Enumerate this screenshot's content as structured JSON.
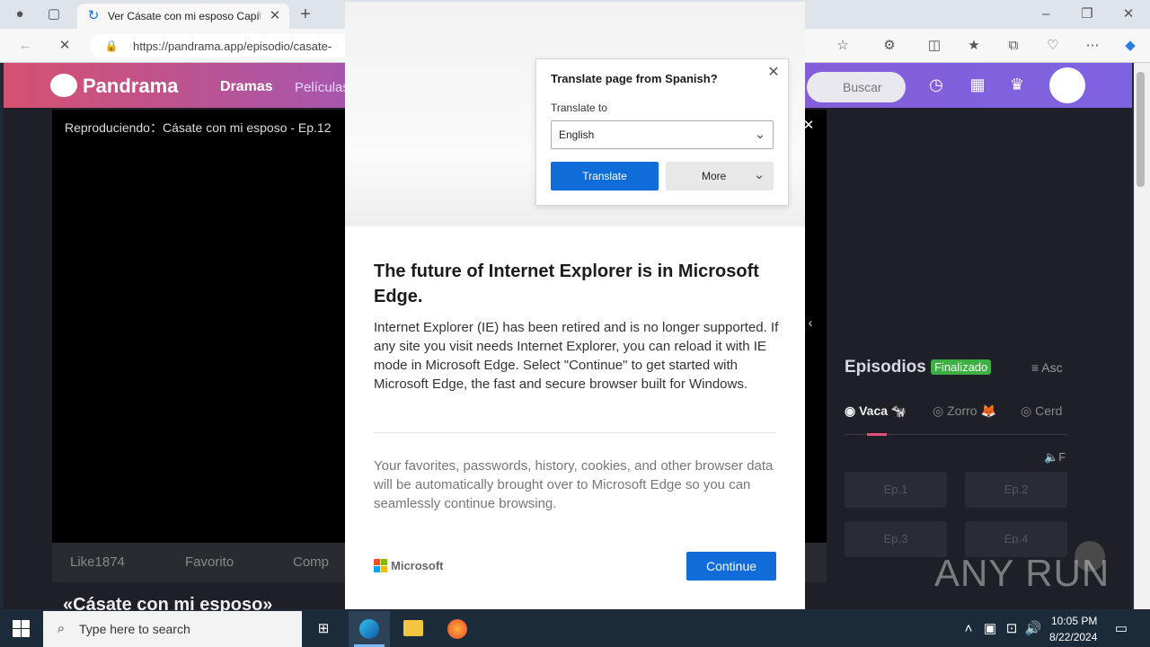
{
  "browser": {
    "tab_title": "Ver Cásate con mi esposo Capítul",
    "url": "https://pandrama.app/episodio/casate-"
  },
  "site": {
    "logo_text": "Pandrama",
    "nav": [
      "Dramas",
      "Películas"
    ],
    "search_placeholder": "Buscar",
    "now_playing": "Reproduciendo：Cásate con mi esposo - Ep.12",
    "actions": {
      "like": "Like1874",
      "favorite": "Favorito",
      "share": "Comp"
    },
    "episodes_title": "Episodios",
    "status_badge": "Finalizado",
    "sort_label": "Asc",
    "groups": [
      "Vaca 🐄",
      "Zorro 🦊",
      "Cerd"
    ],
    "lang_label": "F",
    "episodes": [
      "Ep.1",
      "Ep.2",
      "Ep.3",
      "Ep.4"
    ],
    "bottom_text": "«Cásate con mi esposo»",
    "colors": {
      "accent_start": "#d4506f",
      "accent_end": "#7d63e0",
      "badge": "#3cb043"
    }
  },
  "translate": {
    "title": "Translate page from Spanish?",
    "to_label": "Translate to",
    "language": "English",
    "translate_btn": "Translate",
    "more_btn": "More"
  },
  "modal": {
    "heading": "The future of Internet Explorer is in Microsoft Edge.",
    "body": "Internet Explorer (IE) has been retired and is no longer supported. If any site you visit needs Internet Explorer, you can reload it with IE mode in Microsoft Edge. Select \"Continue\" to get started with Microsoft Edge, the fast and secure browser built for Windows.",
    "secondary": "Your favorites, passwords, history, cookies, and other browser data will be automatically brought over to Microsoft Edge so you can seamlessly continue browsing.",
    "brand": "Microsoft",
    "continue_btn": "Continue"
  },
  "taskbar": {
    "search_placeholder": "Type here to search",
    "time": "10:05 PM",
    "date": "8/22/2024"
  },
  "watermark": "ANY RUN"
}
